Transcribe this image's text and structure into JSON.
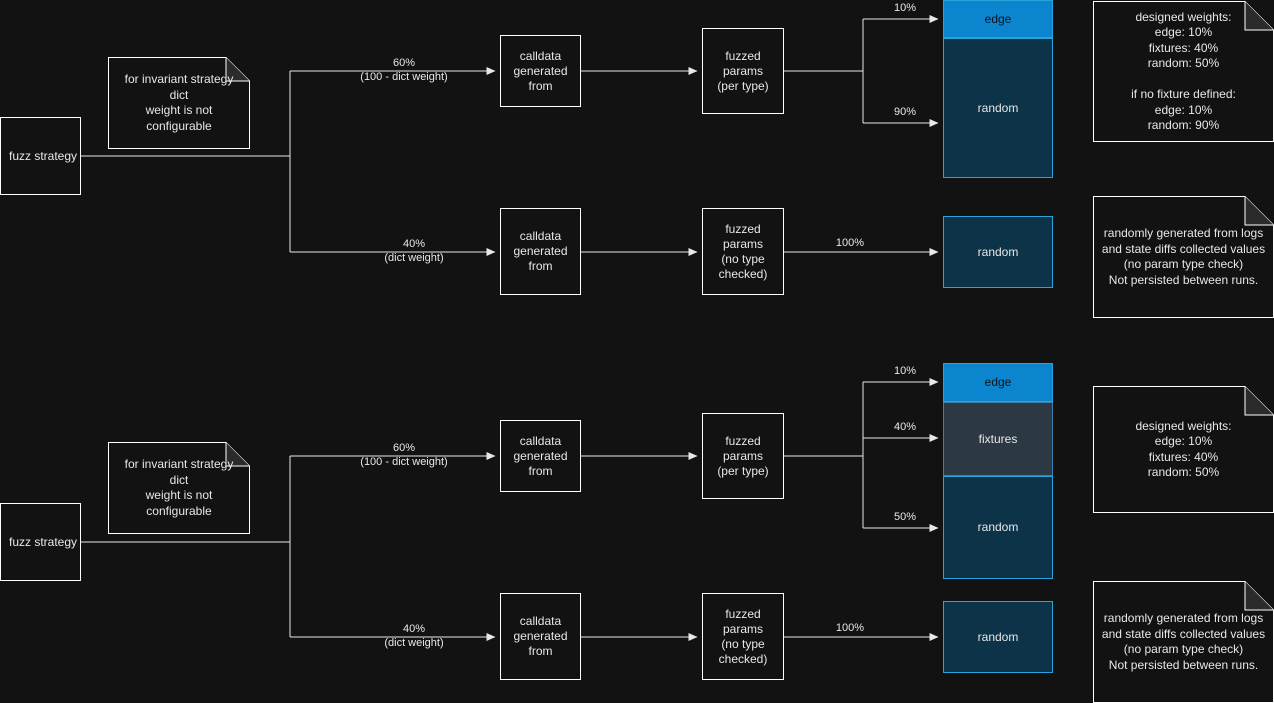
{
  "colors": {
    "background": "#121212",
    "stroke": "#e8e8e8",
    "edge_block": "#0b85ce",
    "fixtures_block": "#2d3845",
    "random_block": "#0d3349",
    "block_border": "#29a8e0"
  },
  "diagrams": [
    {
      "id": "with-fixtures-undefined",
      "start": {
        "label": "fuzz strategy"
      },
      "note_dict_weight": {
        "text": "for invariant strategy dict\nweight is not configurable"
      },
      "branches": [
        {
          "id": "top",
          "edge_label": "60%\n(100 - dict weight)",
          "calldata": {
            "label": "calldata\ngenerated\nfrom"
          },
          "params": {
            "label": "fuzzed\nparams\n(per type)"
          },
          "outcomes": [
            {
              "percent": "10%",
              "label": "edge",
              "kind": "edge"
            },
            {
              "percent": "90%",
              "label": "random",
              "kind": "random"
            }
          ]
        },
        {
          "id": "bottom",
          "edge_label": "40%\n(dict weight)",
          "calldata": {
            "label": "calldata\ngenerated\nfrom"
          },
          "params": {
            "label": "fuzzed\nparams\n(no type\nchecked)"
          },
          "outcomes": [
            {
              "percent": "100%",
              "label": "random",
              "kind": "random"
            }
          ]
        }
      ],
      "note_weights": {
        "text": "designed weights:\nedge: 10%\nfixtures: 40%\nrandom: 50%\n\nif no fixture defined:\nedge: 10%\nrandom: 90%"
      },
      "note_random": {
        "text": "randomly generated from logs\nand state diffs collected values\n(no param type check)\nNot persisted between runs."
      }
    },
    {
      "id": "with-fixtures-defined",
      "start": {
        "label": "fuzz strategy"
      },
      "note_dict_weight": {
        "text": "for invariant strategy dict\nweight is not configurable"
      },
      "branches": [
        {
          "id": "top",
          "edge_label": "60%\n(100 - dict weight)",
          "calldata": {
            "label": "calldata\ngenerated\nfrom"
          },
          "params": {
            "label": "fuzzed\nparams\n(per type)"
          },
          "outcomes": [
            {
              "percent": "10%",
              "label": "edge",
              "kind": "edge"
            },
            {
              "percent": "40%",
              "label": "fixtures",
              "kind": "fixtures"
            },
            {
              "percent": "50%",
              "label": "random",
              "kind": "random"
            }
          ]
        },
        {
          "id": "bottom",
          "edge_label": "40%\n(dict weight)",
          "calldata": {
            "label": "calldata\ngenerated\nfrom"
          },
          "params": {
            "label": "fuzzed\nparams\n(no type\nchecked)"
          },
          "outcomes": [
            {
              "percent": "100%",
              "label": "random",
              "kind": "random"
            }
          ]
        }
      ],
      "note_weights": {
        "text": "designed weights:\nedge: 10%\nfixtures: 40%\nrandom: 50%"
      },
      "note_random": {
        "text": "randomly generated from logs\nand state diffs collected values\n(no param type check)\nNot persisted between runs."
      }
    }
  ]
}
